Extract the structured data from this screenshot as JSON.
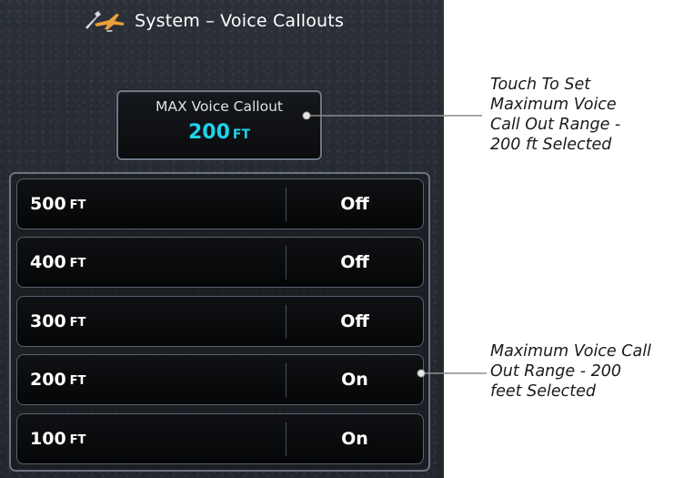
{
  "header": {
    "title": "System – Voice Callouts",
    "icon": "wrench-airplane-icon"
  },
  "max_voice_callout": {
    "label": "MAX Voice Callout",
    "value": "200",
    "unit": "FT",
    "value_color": "#1fd3ea"
  },
  "rows": [
    {
      "altitude": "500",
      "unit": "FT",
      "state": "Off"
    },
    {
      "altitude": "400",
      "unit": "FT",
      "state": "Off"
    },
    {
      "altitude": "300",
      "unit": "FT",
      "state": "Off"
    },
    {
      "altitude": "200",
      "unit": "FT",
      "state": "On"
    },
    {
      "altitude": "100",
      "unit": "FT",
      "state": "On"
    }
  ],
  "annotations": {
    "top": [
      "Touch To Set",
      "Maximum Voice",
      "Call Out Range -",
      "200 ft Selected"
    ],
    "bottom": [
      "Maximum Voice Call",
      "Out Range - 200",
      "feet Selected"
    ]
  }
}
